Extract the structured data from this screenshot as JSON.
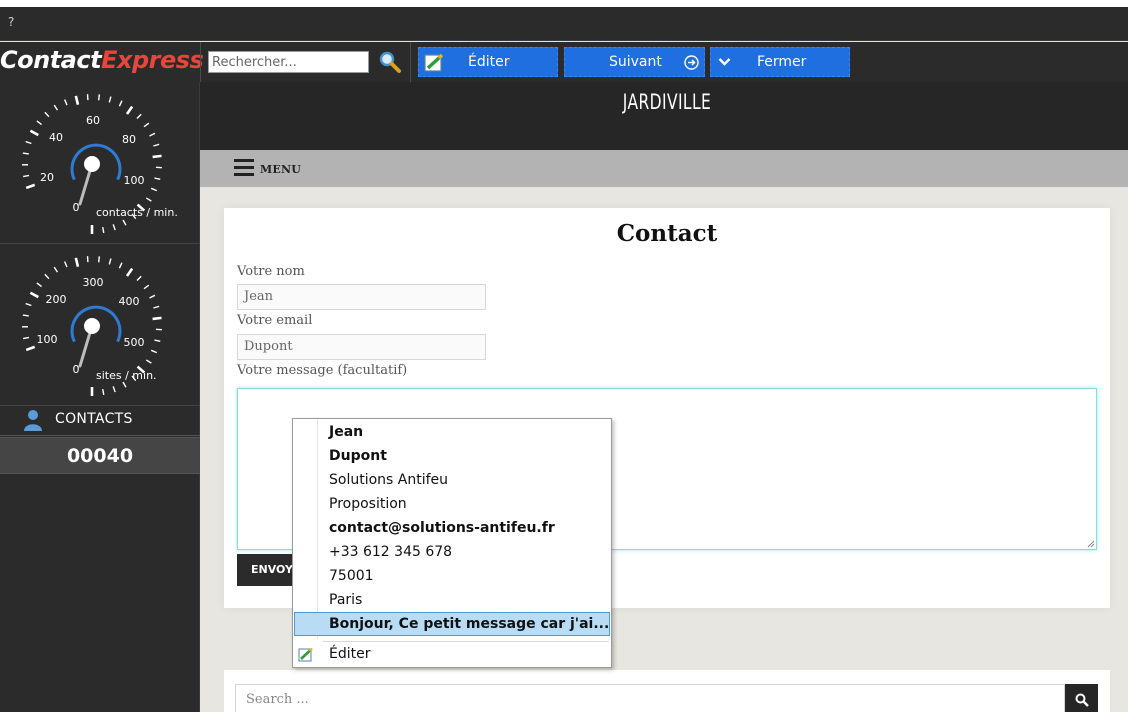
{
  "toolbar": {
    "question_mark": "?",
    "logo_contact": "Contact",
    "logo_express": "Express",
    "search_placeholder": "Rechercher...",
    "edit_label": "Éditer",
    "next_label": "Suivant",
    "close_label": "Fermer",
    "accent_color": "#1f6fe0"
  },
  "sidebar": {
    "gauge1": {
      "ticks": [
        "0",
        "20",
        "40",
        "60",
        "80",
        "100"
      ],
      "unit": "contacts / min."
    },
    "gauge2": {
      "ticks": [
        "0",
        "100",
        "200",
        "300",
        "400",
        "500"
      ],
      "unit": "sites / min."
    },
    "contacts_label": "CONTACTS",
    "counter": "00040"
  },
  "site": {
    "title": "JARDIVILLE",
    "menu_label": "MENU",
    "form": {
      "title": "Contact",
      "name_label": "Votre nom",
      "name_value": "Jean",
      "email_label": "Votre email",
      "email_value": "Dupont",
      "message_label": "Votre message (facultatif)",
      "send_label": "ENVOYER"
    },
    "search_placeholder": "Search ..."
  },
  "context_menu": {
    "items": [
      "Jean",
      "Dupont",
      "Solutions Antifeu",
      "Proposition",
      "contact@solutions-antifeu.fr",
      "+33 612 345 678",
      "75001",
      "Paris",
      "Bonjour, Ce petit message car j'ai..."
    ],
    "edit_label": "Éditer"
  }
}
